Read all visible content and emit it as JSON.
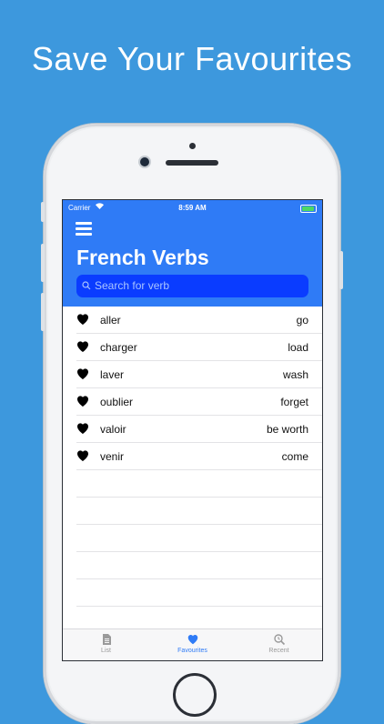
{
  "headline": "Save Your Favourites",
  "status": {
    "carrier": "Carrier",
    "time": "8:59 AM"
  },
  "header": {
    "title": "French Verbs",
    "search_placeholder": "Search for verb"
  },
  "favourites": [
    {
      "french": "aller",
      "english": "go"
    },
    {
      "french": "charger",
      "english": "load"
    },
    {
      "french": "laver",
      "english": "wash"
    },
    {
      "french": "oublier",
      "english": "forget"
    },
    {
      "french": "valoir",
      "english": "be worth"
    },
    {
      "french": "venir",
      "english": "come"
    }
  ],
  "tabs": [
    {
      "label": "List",
      "icon": "document-icon",
      "active": false
    },
    {
      "label": "Favourites",
      "icon": "heart-icon",
      "active": true
    },
    {
      "label": "Recent",
      "icon": "recent-search-icon",
      "active": false
    }
  ],
  "colors": {
    "background": "#3d98dd",
    "accent": "#2f7bf6",
    "search_field": "#0a3cff"
  }
}
